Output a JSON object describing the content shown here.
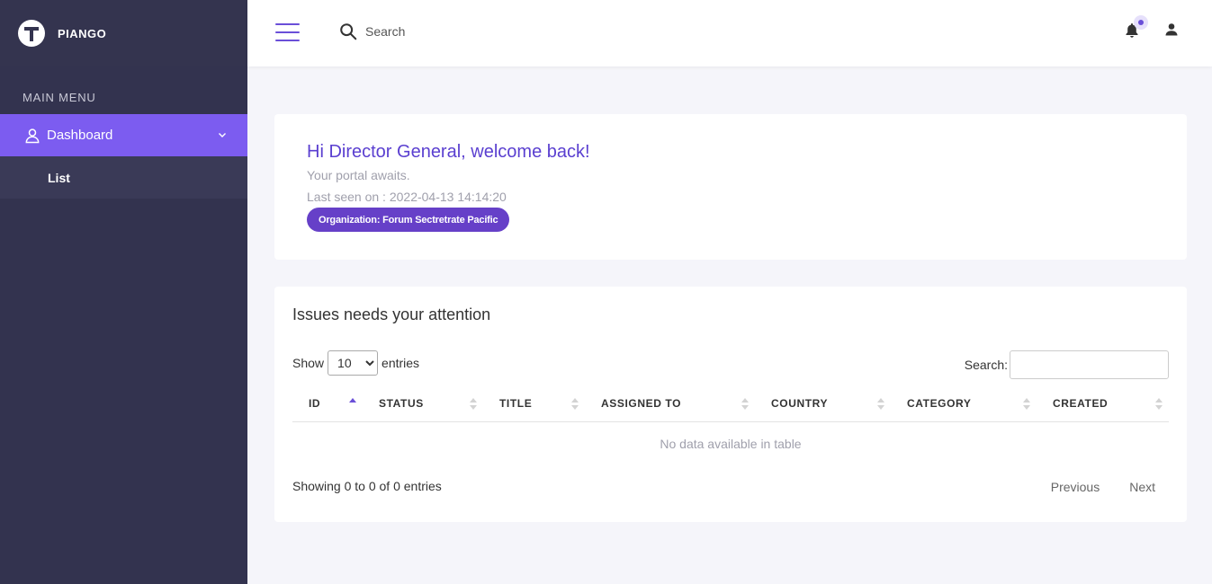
{
  "brand": {
    "name": "PIANGO"
  },
  "sidebar": {
    "menu_title": "MAIN MENU",
    "items": [
      {
        "label": "Dashboard",
        "icon": "user-outline-icon",
        "expanded": true,
        "children": [
          {
            "label": "List"
          }
        ]
      }
    ]
  },
  "topbar": {
    "search_placeholder": "Search",
    "notification_has_unread": true,
    "accent_color": "#6a4fd8"
  },
  "welcome": {
    "greeting": "Hi Director General, welcome back!",
    "subtitle": "Your portal awaits.",
    "last_seen": "Last seen on : 2022-04-13 14:14:20",
    "organization": "Organization: Forum Sectretrate Pacific"
  },
  "issues": {
    "title": "Issues needs your attention",
    "show_label": "Show",
    "entries_label": "entries",
    "page_length": "10",
    "search_label": "Search:",
    "columns": [
      "ID",
      "STATUS",
      "TITLE",
      "ASSIGNED TO",
      "COUNTRY",
      "CATEGORY",
      "CREATED"
    ],
    "sorted_column": "ID",
    "empty_message": "No data available in table",
    "info": "Showing 0 to 0 of 0 entries",
    "prev_label": "Previous",
    "next_label": "Next"
  }
}
